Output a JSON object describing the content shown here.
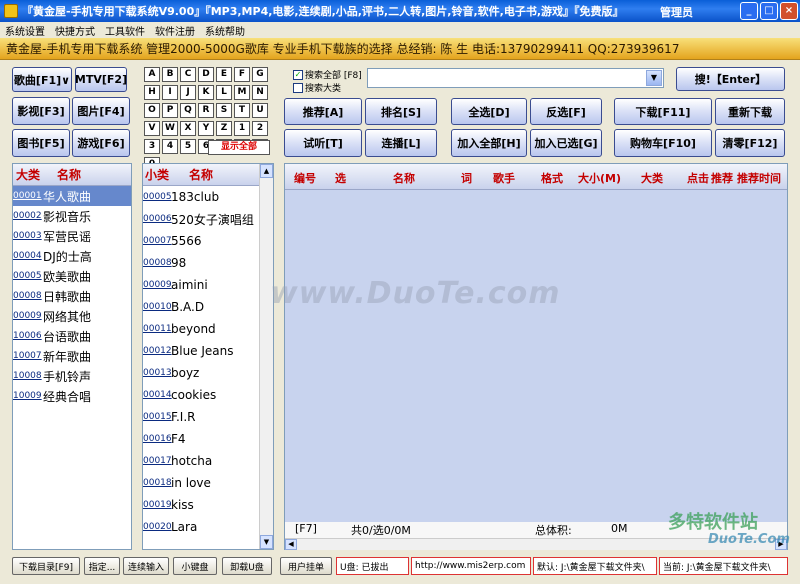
{
  "window": {
    "title": "『黄金屋-手机专用下载系统V9.00』『MP3,MP4,电影,连续剧,小品,评书,二人转,图片,铃音,软件,电子书,游戏』『免费版』",
    "admin": "管理员"
  },
  "menu": [
    "系统设置",
    "快捷方式",
    "工具软件",
    "软件注册",
    "系统帮助"
  ],
  "banner": "黄金屋-手机专用下载系统   管理2000-5000G歌库 专业手机下载族的选择 总经销: 陈 生 电话:13790299411 QQ:273939617",
  "categories": {
    "music": "歌曲[F1]∨",
    "mtv": "MTV[F2]",
    "video": "影视[F3]",
    "picture": "图片[F4]",
    "book": "图书[F5]",
    "game": "游戏[F6]"
  },
  "keyboard": {
    "keys": [
      "A",
      "B",
      "C",
      "D",
      "E",
      "F",
      "G",
      "H",
      "I",
      "J",
      "K",
      "L",
      "M",
      "N",
      "O",
      "P",
      "Q",
      "R",
      "S",
      "T",
      "U",
      "V",
      "W",
      "X",
      "Y",
      "Z",
      "1",
      "2",
      "3",
      "4",
      "5",
      "6",
      "7",
      "8",
      "9",
      "0"
    ],
    "show_all": "显示全部"
  },
  "search": {
    "all_label": "搜索全部 [F8]",
    "big_label": "搜索大类",
    "all_checked": true,
    "big_checked": false,
    "query": "",
    "button": "搜!【Enter】"
  },
  "actions": {
    "recommend": "推荐[A]",
    "rank": "排名[S]",
    "select_all": "全选[D]",
    "invert": "反选[F]",
    "download": "下载[F11]",
    "redownload": "重新下载",
    "preview": "试听[T]",
    "play": "连播[L]",
    "add_all": "加入全部[H]",
    "add_selected": "加入已选[G]",
    "cart": "购物车[F10]",
    "clear": "清零[F12]"
  },
  "left_list": {
    "headers": [
      "大类",
      "名称"
    ],
    "items": [
      {
        "code": "00001",
        "name": "华人歌曲"
      },
      {
        "code": "00002",
        "name": "影视音乐"
      },
      {
        "code": "00003",
        "name": "军营民谣"
      },
      {
        "code": "00004",
        "name": "DJ的士高"
      },
      {
        "code": "00005",
        "name": "欧美歌曲"
      },
      {
        "code": "00008",
        "name": "日韩歌曲"
      },
      {
        "code": "00009",
        "name": "网络其他"
      },
      {
        "code": "10006",
        "name": "台语歌曲"
      },
      {
        "code": "10007",
        "name": "新年歌曲"
      },
      {
        "code": "10008",
        "name": "手机铃声"
      },
      {
        "code": "10009",
        "name": "经典合唱"
      }
    ]
  },
  "mid_list": {
    "headers": [
      "小类",
      "名称"
    ],
    "items": [
      {
        "code": "00005",
        "name": "183club"
      },
      {
        "code": "00006",
        "name": "520女子演唱组"
      },
      {
        "code": "00007",
        "name": "5566"
      },
      {
        "code": "00008",
        "name": "98"
      },
      {
        "code": "00009",
        "name": "aimini"
      },
      {
        "code": "00010",
        "name": "B.A.D"
      },
      {
        "code": "00011",
        "name": "beyond"
      },
      {
        "code": "00012",
        "name": "Blue Jeans"
      },
      {
        "code": "00013",
        "name": "boyz"
      },
      {
        "code": "00014",
        "name": "cookies"
      },
      {
        "code": "00015",
        "name": "F.I.R"
      },
      {
        "code": "00016",
        "name": "F4"
      },
      {
        "code": "00017",
        "name": "hotcha"
      },
      {
        "code": "00018",
        "name": "in love"
      },
      {
        "code": "00019",
        "name": "kiss"
      },
      {
        "code": "00020",
        "name": "Lara"
      }
    ]
  },
  "results": {
    "headers": [
      "编号",
      "选",
      "名称",
      "词",
      "歌手",
      "格式",
      "大小(M)",
      "大类",
      "点击",
      "推荐",
      "推荐时间"
    ],
    "footer": {
      "key": "[F7]",
      "count": "共0/选0/0M",
      "total_label": "总体积:",
      "total": "0M"
    }
  },
  "status": {
    "dir": "下载目录[F9]",
    "assign": "指定...",
    "continuous": "连续输入",
    "keyboard": "小键盘",
    "unload": "卸载U盘",
    "user": "用户挂单",
    "usb": "U盘: 已拔出",
    "url": "http://www.mis2erp.com",
    "default_path": "默认: J:\\黄金屋下载文件夹\\",
    "current_path": "当前: J:\\黄金屋下载文件夹\\"
  },
  "watermark": "www.DuoTe.com",
  "corner_logo": "多特软件站",
  "corner_logo2": "DuoTe.Com"
}
